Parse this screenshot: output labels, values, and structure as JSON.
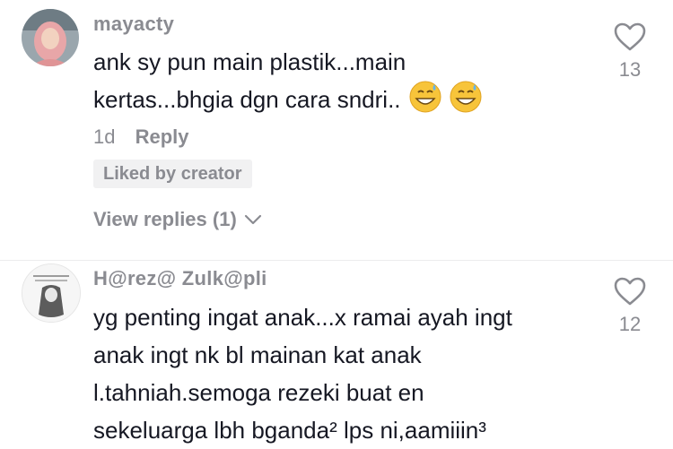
{
  "comments": [
    {
      "username": "mayacty",
      "text_lines": [
        "ank sy pun main plastik...main",
        "kertas...bhgia dgn cara sndri.."
      ],
      "emoji": [
        "grinning-sweat-face",
        "grinning-sweat-face"
      ],
      "time": "1d",
      "reply_label": "Reply",
      "badge": "Liked by creator",
      "view_replies": "View replies (1)",
      "likes": "13"
    },
    {
      "username": "H@rez@ Zulk@pli",
      "text_lines": [
        "yg penting ingat anak...x ramai ayah ingt",
        "anak ingt nk bl mainan kat anak",
        "l.tahniah.semoga rezeki buat en",
        "sekeluarga lbh bganda² lps ni,aamiiin³"
      ],
      "likes": "12"
    }
  ],
  "colors": {
    "text": "#161823",
    "muted": "#8a8b91",
    "badge_bg": "#f1f1f2"
  }
}
